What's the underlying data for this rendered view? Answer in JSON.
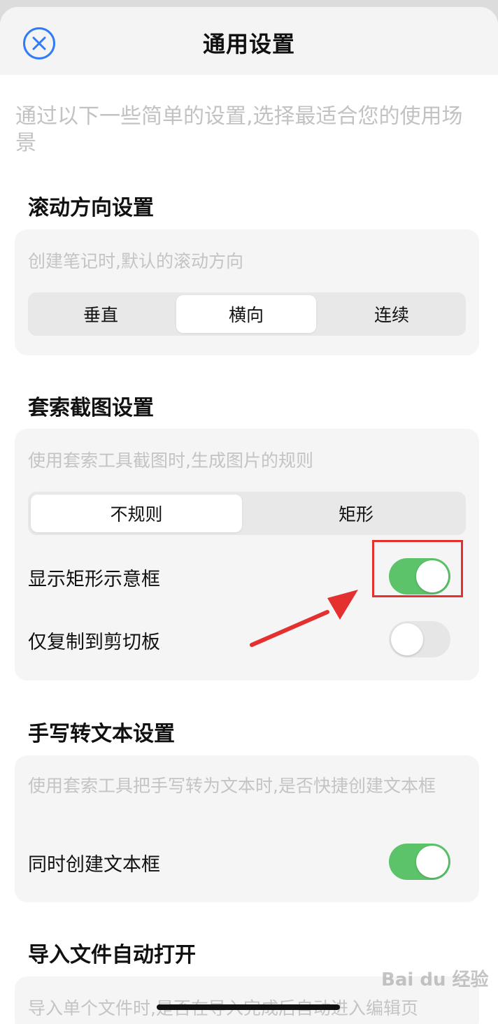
{
  "header": {
    "title": "通用设置"
  },
  "intro": "通过以下一些简单的设置,选择最适合您的使用场景",
  "scroll_section": {
    "title": "滚动方向设置",
    "description": "创建笔记时,默认的滚动方向",
    "options": [
      "垂直",
      "横向",
      "连续"
    ],
    "selected": "横向"
  },
  "lasso_section": {
    "title": "套索截图设置",
    "description": "使用套索工具截图时,生成图片的规则",
    "options": [
      "不规则",
      "矩形"
    ],
    "selected": "不规则",
    "toggles": [
      {
        "label": "显示矩形示意框",
        "on": true
      },
      {
        "label": "仅复制到剪切板",
        "on": false
      }
    ]
  },
  "handwriting_section": {
    "title": "手写转文本设置",
    "description": "使用套索工具把手写转为文本时,是否快捷创建文本框",
    "toggles": [
      {
        "label": "同时创建文本框",
        "on": true
      }
    ]
  },
  "import_section": {
    "title": "导入文件自动打开",
    "description": "导入单个文件时,是否在导入完成后自动进入编辑页"
  },
  "watermark": "Bai du 经验",
  "colors": {
    "accent": "#2f7cf6",
    "toggle_on": "#5cc36b",
    "annotation": "#e53030"
  }
}
